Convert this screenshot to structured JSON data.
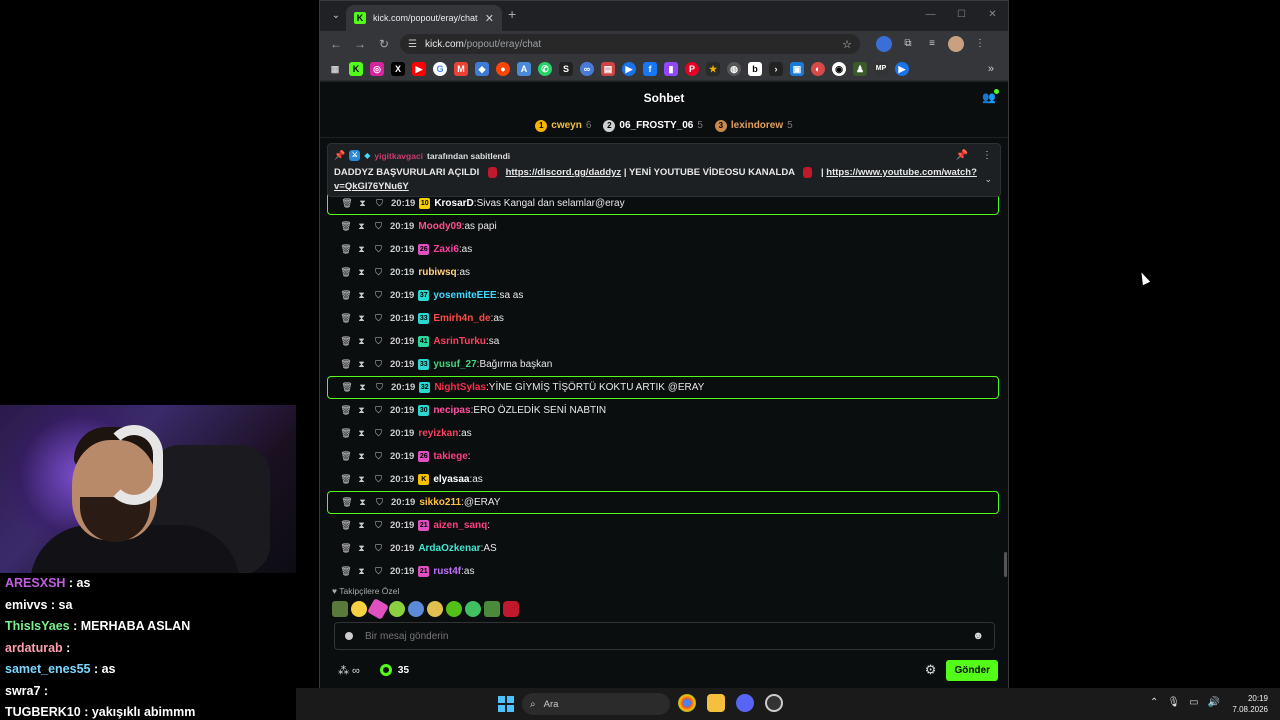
{
  "overlay_chat": [
    {
      "user": "ARESXSH",
      "msg": "as",
      "color": "#c060e0"
    },
    {
      "user": "emivvs",
      "msg": "sa",
      "color": "#ffffff"
    },
    {
      "user": "ThisIsYaes",
      "msg": "MERHABA ASLAN",
      "color": "#7cf08a"
    },
    {
      "user": "ardaturab",
      "msg": "",
      "color": "#ff9fb0"
    },
    {
      "user": "samet_enes55",
      "msg": "as",
      "color": "#7cd7ff"
    },
    {
      "user": "swra7",
      "msg": "",
      "color": "#ffffff"
    },
    {
      "user": "TUGBERK10",
      "msg": "yakışıklı abimmm",
      "color": "#ffffff"
    }
  ],
  "browser": {
    "tab_title": "kick.com/popout/eray/chat",
    "url_host": "kick.com",
    "url_path": "/popout/eray/chat"
  },
  "chat": {
    "title": "Sohbet",
    "leaderboard": [
      {
        "rank": "1",
        "name": "cweyn",
        "count": "6",
        "color": "#f5b400",
        "name_color": "#f0c040"
      },
      {
        "rank": "2",
        "name": "06_FROSTY_06",
        "count": "5",
        "color": "#d0d0d0",
        "name_color": "#ffffff"
      },
      {
        "rank": "3",
        "name": "lexindorew",
        "count": "5",
        "color": "#c88a4a",
        "name_color": "#e0a060"
      }
    ],
    "pinned": {
      "by_user": "yigitkavgaci",
      "by_text": "tarafından sabitlendi",
      "text1": "DADDYZ BAŞVURULARI AÇILDI",
      "link1": "https://discord.gg/daddyz",
      "text2": "| YENİ YOUTUBE VİDEOSU KANALDA",
      "text3": "|",
      "link2": "https://www.youtube.com/watch?v=QkGI76YNu6Y"
    },
    "messages": [
      {
        "time": "20:19",
        "badge": "10",
        "badge_color": "#f5d000",
        "user": "KrosarD",
        "user_color": "#ffffff",
        "text": "Sivas Kangal dan selamlar@eray",
        "hl": true
      },
      {
        "time": "20:19",
        "badge": "",
        "badge_color": "",
        "user": "Moody09",
        "user_color": "#ff4f8b",
        "text": "as papi",
        "hl": false
      },
      {
        "time": "20:19",
        "badge": "26",
        "badge_color": "#e050c0",
        "user": "Zaxi6",
        "user_color": "#ff3fa0",
        "text": "as",
        "hl": false
      },
      {
        "time": "20:19",
        "badge": "",
        "badge_color": "",
        "user": "rubiwsq",
        "user_color": "#ffd080",
        "text": "as",
        "hl": false
      },
      {
        "time": "20:19",
        "badge": "37",
        "badge_color": "#2ad8d0",
        "user": "yosemiteEEE",
        "user_color": "#3fd8ff",
        "text": "sa as",
        "hl": false
      },
      {
        "time": "20:19",
        "badge": "33",
        "badge_color": "#2ad8d0",
        "user": "Emirh4n_de",
        "user_color": "#ff4a4a",
        "text": "as",
        "hl": false
      },
      {
        "time": "20:19",
        "badge": "41",
        "badge_color": "#2ad8a0",
        "user": "AsrinTurku",
        "user_color": "#ff3f5f",
        "text": "sa",
        "hl": false
      },
      {
        "time": "20:19",
        "badge": "33",
        "badge_color": "#2ad8d0",
        "user": "yusuf_27",
        "user_color": "#3fd87f",
        "text": "Bağırma başkan",
        "hl": false
      },
      {
        "time": "20:19",
        "badge": "32",
        "badge_color": "#2ad8d0",
        "user": "NightSylas",
        "user_color": "#ff2a4a",
        "text": "YİNE GİYMİŞ TİŞÖRTÜ KOKTU ARTIK @ERAY",
        "hl": true
      },
      {
        "time": "20:19",
        "badge": "30",
        "badge_color": "#2ad8d0",
        "user": "necipas",
        "user_color": "#ff4fa0",
        "text": "ERO ÖZLEDİK SENİ NABTIN",
        "hl": false
      },
      {
        "time": "20:19",
        "badge": "",
        "badge_color": "",
        "user": "reyizkan",
        "user_color": "#ff3f5f",
        "text": "as",
        "hl": false
      },
      {
        "time": "20:19",
        "badge": "26",
        "badge_color": "#e050c0",
        "user": "takiege",
        "user_color": "#ff3f7f",
        "text": "",
        "hl": false
      },
      {
        "time": "20:19",
        "badge": "K",
        "badge_color": "#f5c000",
        "user": "elyasaa",
        "user_color": "#ffffff",
        "text": "as",
        "hl": false
      },
      {
        "time": "20:19",
        "badge": "",
        "badge_color": "",
        "user": "sikko211",
        "user_color": "#ffc040",
        "text": "@ERAY",
        "hl": true
      },
      {
        "time": "20:19",
        "badge": "21",
        "badge_color": "#e050c0",
        "user": "aizen_sanq",
        "user_color": "#ff3f7f",
        "text": "",
        "hl": false
      },
      {
        "time": "20:19",
        "badge": "",
        "badge_color": "",
        "user": "ArdaOzkenar",
        "user_color": "#3fe8d0",
        "text": "AS",
        "hl": false
      },
      {
        "time": "20:19",
        "badge": "21",
        "badge_color": "#e050c0",
        "user": "rust4f",
        "user_color": "#c070ff",
        "text": "as",
        "hl": false
      }
    ],
    "followers_label": "Takipçilere Özel",
    "input_placeholder": "Bir mesaj gönderin",
    "kick_count": "35",
    "send_label": "Gönder"
  },
  "taskbar": {
    "search_label": "Ara",
    "time": "20:19",
    "date": "7.08.2026"
  },
  "colors": {
    "accent": "#53fc18",
    "chat_bg": "#0b0e0f"
  }
}
